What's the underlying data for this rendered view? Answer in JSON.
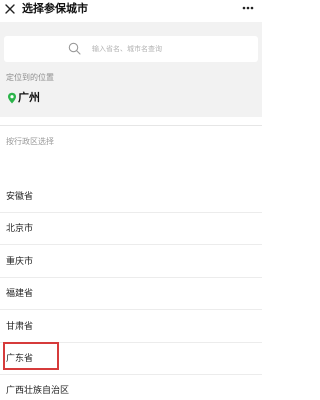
{
  "header": {
    "title": "选择参保城市",
    "close_icon": "close-icon",
    "more_icon": "more-icon"
  },
  "search": {
    "placeholder": "输入省名、城市名查询",
    "value": "",
    "icon": "search-icon"
  },
  "location": {
    "title": "定位到的位置",
    "city": "广州",
    "pin_color": "#2bb44a"
  },
  "province_list": {
    "title": "按行政区选择",
    "items": [
      {
        "label": "安徽省"
      },
      {
        "label": "北京市"
      },
      {
        "label": "重庆市"
      },
      {
        "label": "福建省"
      },
      {
        "label": "甘肃省"
      },
      {
        "label": "广东省",
        "highlighted": true
      },
      {
        "label": "广西壮族自治区"
      }
    ]
  },
  "colors": {
    "highlight": "#d63b3b",
    "background_gray": "#f2f2f2"
  }
}
